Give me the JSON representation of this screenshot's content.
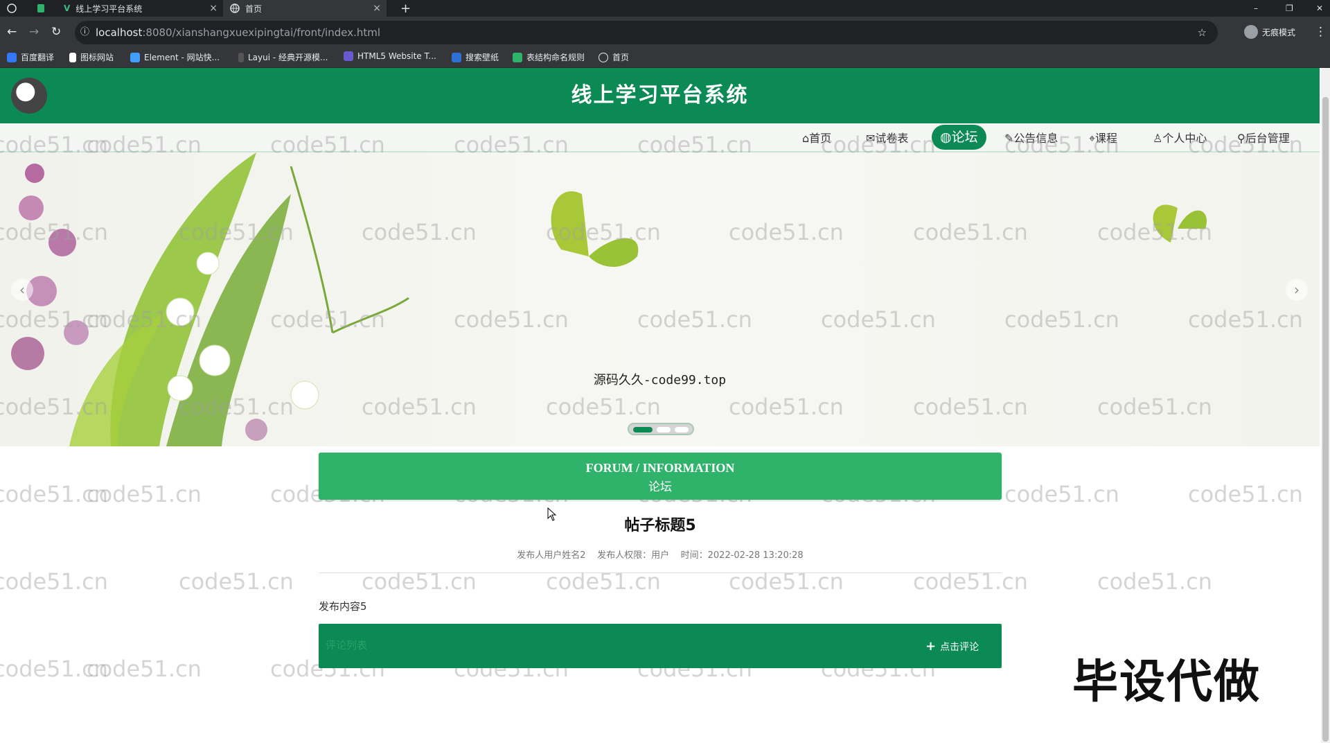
{
  "browser": {
    "tabs": [
      {
        "label": "线上学习平台系统"
      },
      {
        "label": "首页"
      }
    ],
    "url_host": "localhost",
    "url_path": ":8080/xianshangxuexipingtai/front/index.html",
    "profile_label": "无痕模式",
    "bookmarks": [
      {
        "label": "百度翻译"
      },
      {
        "label": "图标网站"
      },
      {
        "label": "Element - 网站快..."
      },
      {
        "label": "Layui - 经典开源模..."
      },
      {
        "label": "HTML5 Website T..."
      },
      {
        "label": "搜索壁纸"
      },
      {
        "label": "表结构命名规则"
      },
      {
        "label": "首页"
      }
    ]
  },
  "site": {
    "title": "线上学习平台系统",
    "brand_color": "#0b8a55"
  },
  "nav": {
    "items": [
      {
        "label": "首页",
        "icon": "home-icon"
      },
      {
        "label": "试卷表",
        "icon": "mail-icon"
      },
      {
        "label": "论坛",
        "icon": "globe-icon",
        "active": true
      },
      {
        "label": "公告信息",
        "icon": "edit-icon"
      },
      {
        "label": "课程",
        "icon": "tag-icon"
      },
      {
        "label": "个人中心",
        "icon": "user-icon"
      },
      {
        "label": "后台管理",
        "icon": "link-icon"
      }
    ]
  },
  "banner": {
    "caption": "源码久久-code99.top",
    "slide_count": 3,
    "active_slide": 1
  },
  "section": {
    "title_en": "FORUM / INFORMATION",
    "title_zh": "论坛"
  },
  "post": {
    "title": "帖子标题5",
    "meta": "发布人用户姓名2    发布人权限：用户    时间：2022-02-28 13:20:28",
    "content": "发布内容5"
  },
  "comment": {
    "placeholder": "评论列表",
    "button_label": "点击评论"
  },
  "watermark": "code51.cn",
  "overlay": "毕设代做"
}
